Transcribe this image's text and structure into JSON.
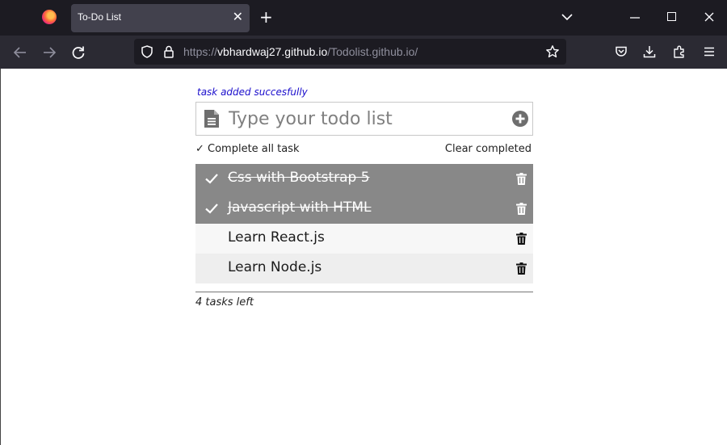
{
  "browser": {
    "tab_title": "To-Do List",
    "url_prefix": "https://",
    "url_host": "vbhardwaj27.github.io",
    "url_path": "/Todolist.github.io/"
  },
  "app": {
    "status_message": "task added succesfully",
    "input_placeholder": "Type your todo list",
    "input_value": "",
    "complete_all_label": "✓ Complete all task",
    "clear_completed_label": "Clear completed",
    "tasks": [
      {
        "text": "Css with Bootstrap 5",
        "completed": true
      },
      {
        "text": "Javascript with HTML",
        "completed": true
      },
      {
        "text": "Learn React.js",
        "completed": false
      },
      {
        "text": "Learn Node.js",
        "completed": false
      }
    ],
    "tasks_left_label": "4 tasks left"
  },
  "colors": {
    "completed_row": "#888888",
    "status_text": "#1a0dcc",
    "chrome_dark": "#1c1b22"
  }
}
